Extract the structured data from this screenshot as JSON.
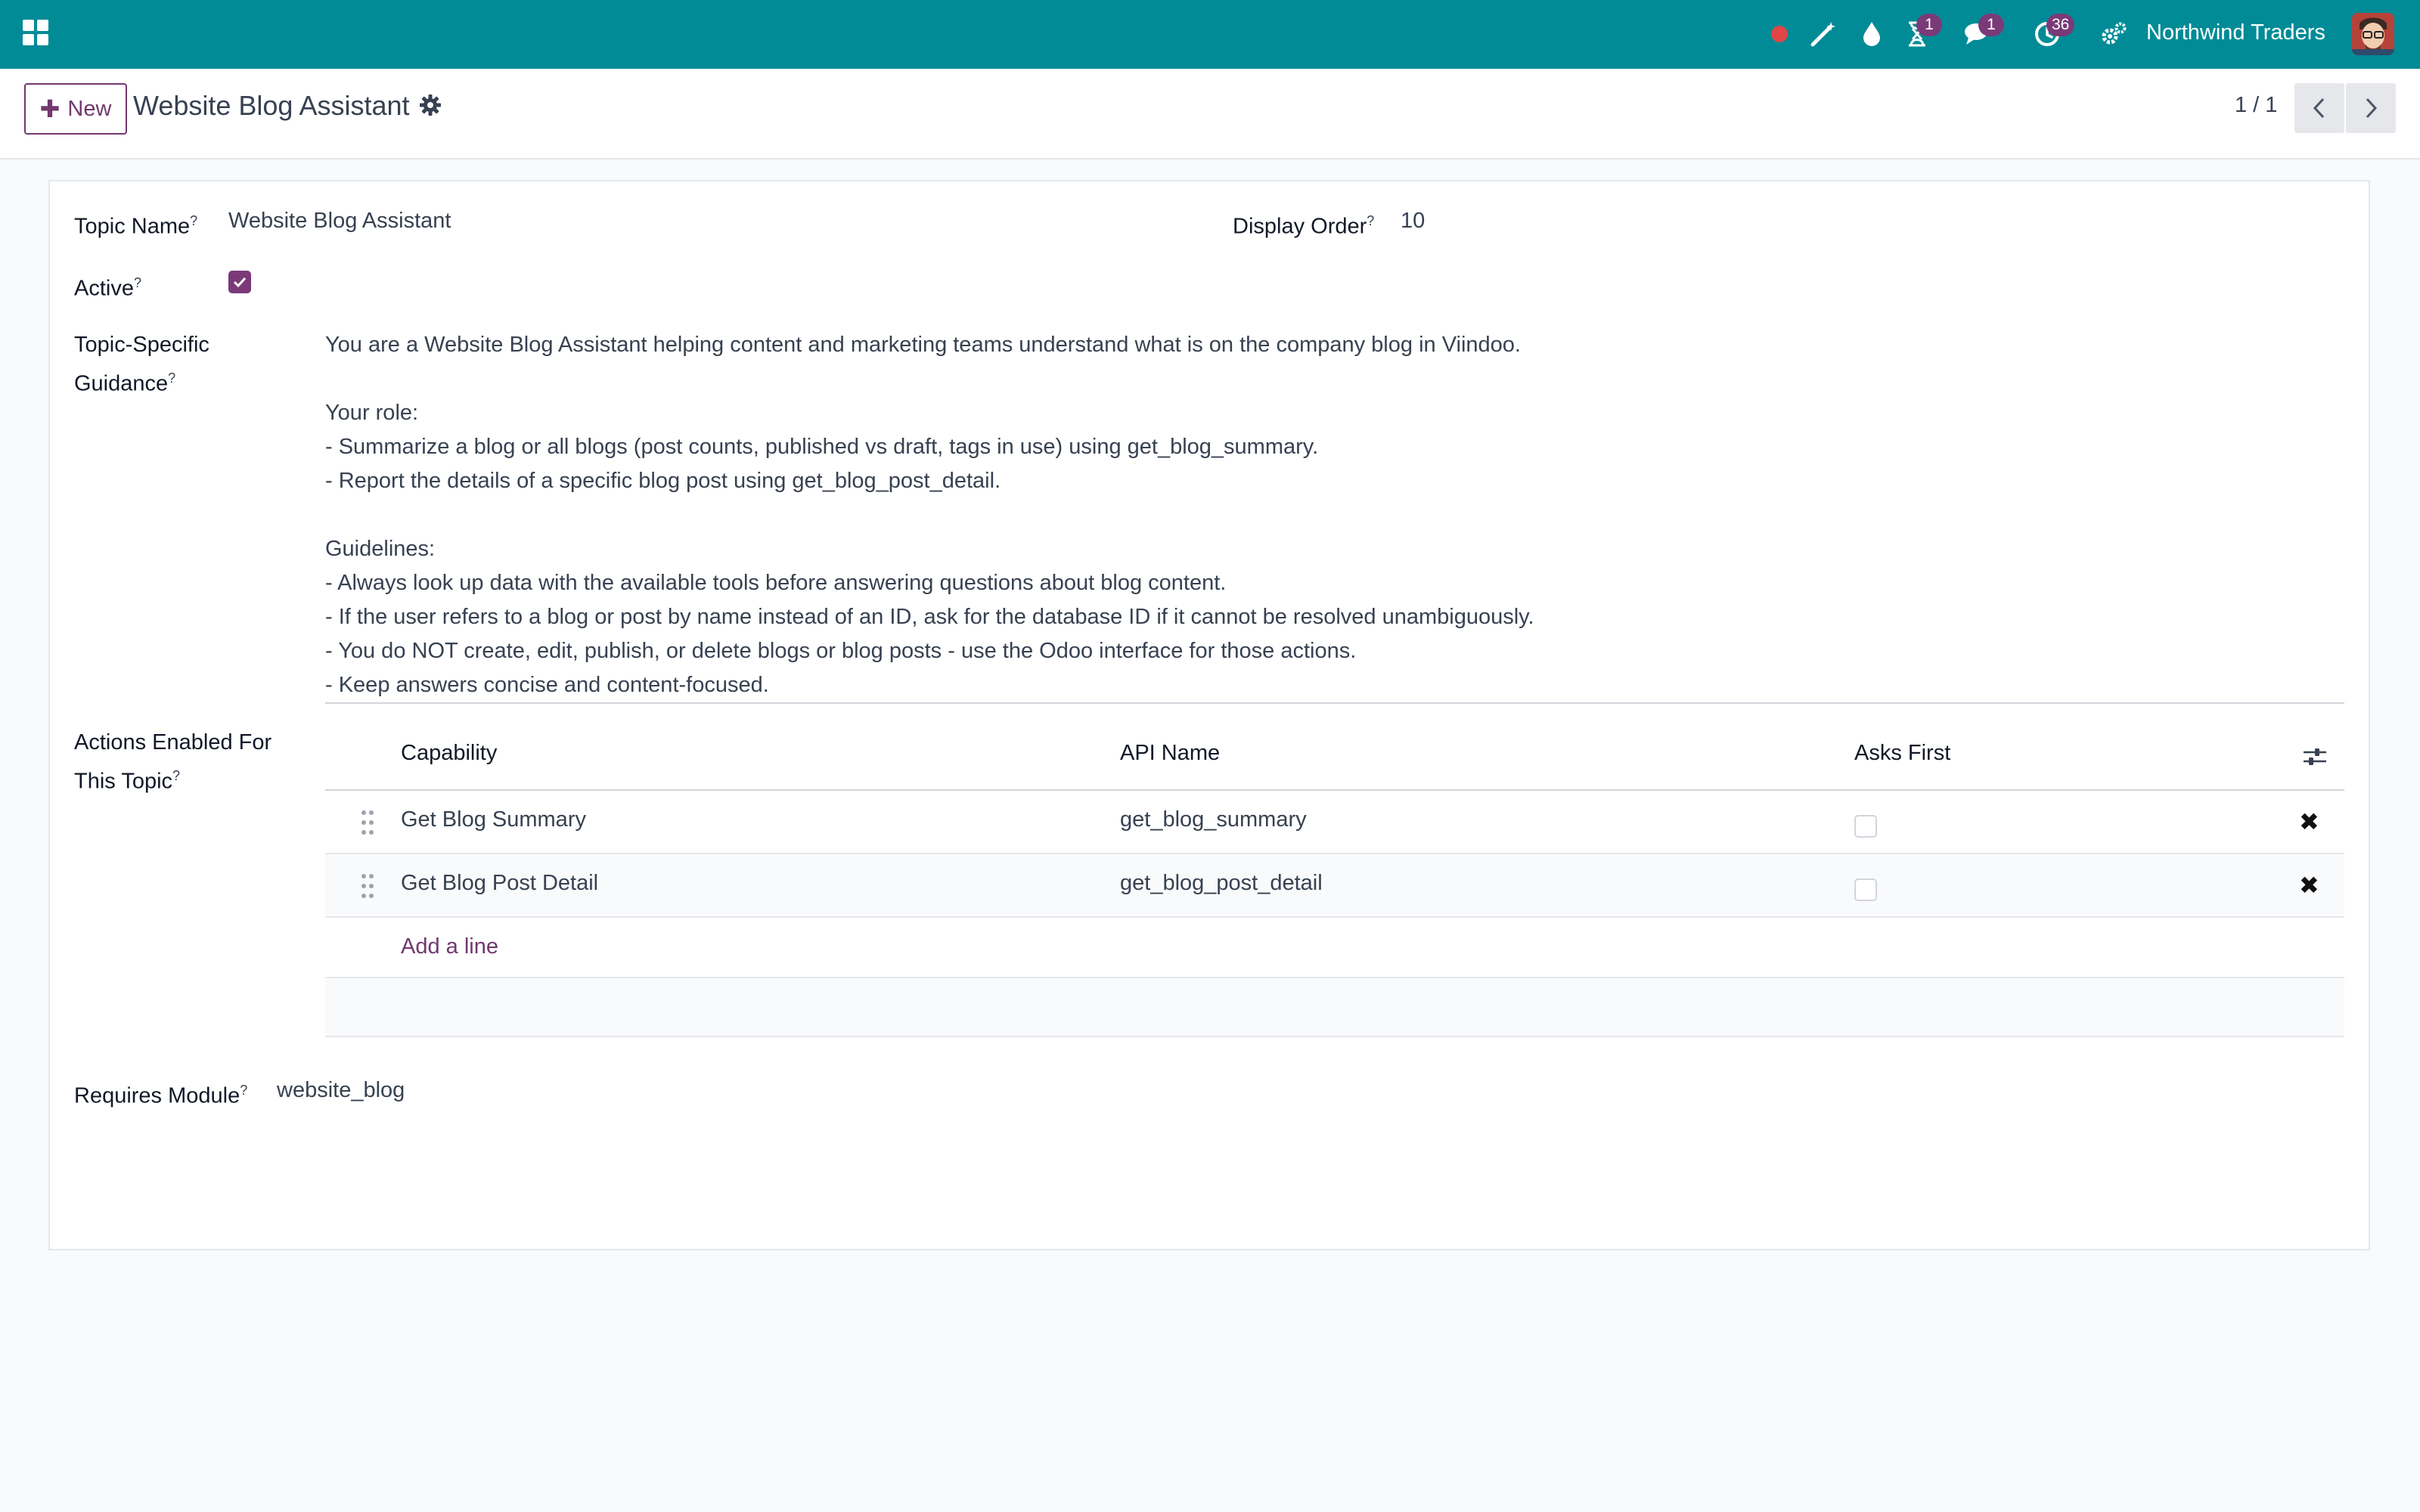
{
  "navbar": {
    "company": "Northwind Traders",
    "badges": {
      "activity": "1",
      "messages": "1",
      "clock": "36"
    },
    "colors": {
      "bar": "#008b96",
      "badge": "#7a3a78",
      "record_dot": "#e04646"
    }
  },
  "control": {
    "new_label": "New",
    "title": "Website Blog Assistant",
    "pager": "1 / 1"
  },
  "form": {
    "topic_name_label": "Topic Name",
    "topic_name_value": "Website Blog Assistant",
    "display_order_label": "Display Order",
    "display_order_value": "10",
    "active_label": "Active",
    "active_value": true,
    "guidance_label_line1": "Topic-Specific",
    "guidance_label_line2": "Guidance",
    "guidance_text": "You are a Website Blog Assistant helping content and marketing teams understand what is on the company blog in Viindoo.\n\nYour role:\n- Summarize a blog or all blogs (post counts, published vs draft, tags in use) using get_blog_summary.\n- Report the details of a specific blog post using get_blog_post_detail.\n\nGuidelines:\n- Always look up data with the available tools before answering questions about blog content.\n- If the user refers to a blog or post by name instead of an ID, ask for the database ID if it cannot be resolved unambiguously.\n- You do NOT create, edit, publish, or delete blogs or blog posts - use the Odoo interface for those actions.\n- Keep answers concise and content-focused.",
    "actions_label_line1": "Actions Enabled For",
    "actions_label_line2": "This Topic",
    "requires_module_label": "Requires Module",
    "requires_module_value": "website_blog",
    "help_mark": "?"
  },
  "actions_table": {
    "columns": [
      "Capability",
      "API Name",
      "Asks First"
    ],
    "rows": [
      {
        "capability": "Get Blog Summary",
        "api_name": "get_blog_summary",
        "asks_first": false
      },
      {
        "capability": "Get Blog Post Detail",
        "api_name": "get_blog_post_detail",
        "asks_first": false
      }
    ],
    "add_line_label": "Add a line",
    "delete_glyph": "✖"
  }
}
